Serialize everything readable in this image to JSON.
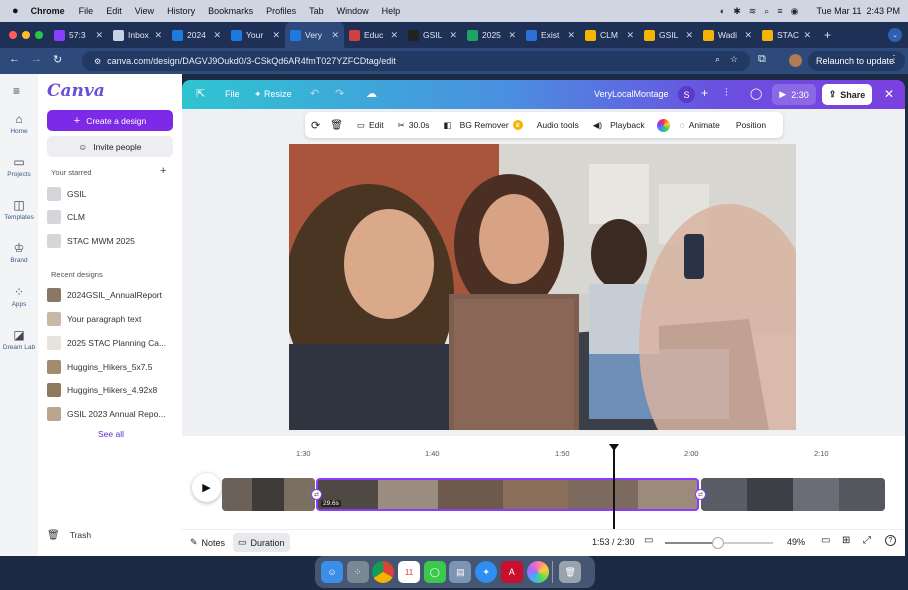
{
  "menubar": {
    "app": "Chrome",
    "items": [
      "File",
      "Edit",
      "View",
      "History",
      "Bookmarks",
      "Profiles",
      "Tab",
      "Window",
      "Help"
    ],
    "datetime": "Tue Mar 11  2:43 PM"
  },
  "tabs": [
    {
      "label": "57:3",
      "favicon_color": "#8a3ffc"
    },
    {
      "label": "Inbox",
      "favicon_color": "#c7d2e6"
    },
    {
      "label": "2024",
      "favicon_color": "#1f7ae0"
    },
    {
      "label": "Your",
      "favicon_color": "#1f7ae0"
    },
    {
      "label": "Very",
      "favicon_color": "#1f7ae0"
    },
    {
      "label": "Educ",
      "favicon_color": "#d04040"
    },
    {
      "label": "GSIL",
      "favicon_color": "#222222"
    },
    {
      "label": "2025",
      "favicon_color": "#1ea362"
    },
    {
      "label": "Exist",
      "favicon_color": "#2a70d9"
    },
    {
      "label": "CLM",
      "favicon_color": "#f4b400"
    },
    {
      "label": "GSIL",
      "favicon_color": "#f4b400"
    },
    {
      "label": "Wadi",
      "favicon_color": "#f4b400"
    },
    {
      "label": "STAC",
      "favicon_color": "#f4b400"
    }
  ],
  "address": {
    "url": "canva.com/design/DAGVJ9Oukd0/3-CSkQd6AR4fmT027YZFCDtag/edit",
    "relaunch": "Relaunch to update"
  },
  "leftnav": [
    {
      "label": "Home",
      "icon": "home-icon"
    },
    {
      "label": "Projects",
      "icon": "folder-icon"
    },
    {
      "label": "Templates",
      "icon": "templates-icon"
    },
    {
      "label": "Brand",
      "icon": "brand-icon"
    },
    {
      "label": "Apps",
      "icon": "apps-icon"
    },
    {
      "label": "Dream Lab",
      "icon": "dreamlab-icon"
    }
  ],
  "panel": {
    "logo": "Canva",
    "create": "Create a design",
    "invite": "Invite people",
    "starred_heading": "Your starred",
    "starred": [
      "GSIL",
      "CLM",
      "STAC MWM 2025"
    ],
    "recent_heading": "Recent designs",
    "recent": [
      "2024GSIL_AnnualReport",
      "Your paragraph text",
      "2025 STAC Planning Ca...",
      "Huggins_Hikers_5x7.5",
      "Huggins_Hikers_4.92x8",
      "GSIL 2023 Annual Repo..."
    ],
    "see_all": "See all",
    "trash": "Trash"
  },
  "topbar": {
    "file": "File",
    "resize": "Resize",
    "title": "VeryLocalMontage",
    "avatar": "S",
    "play_time": "2:30",
    "share": "Share"
  },
  "toolbar": {
    "edit": "Edit",
    "duration": "30.0s",
    "bg_remover": "BG Remover",
    "audio": "Audio tools",
    "playback": "Playback",
    "animate": "Animate",
    "position": "Position"
  },
  "timeline": {
    "ticks": [
      "1:30",
      "1:40",
      "1:50",
      "2:00",
      "2:10"
    ],
    "clip_duration": "29.6s"
  },
  "bottom": {
    "notes": "Notes",
    "duration": "Duration",
    "time": "1:53 / 2:30",
    "zoom": "49%",
    "zoom_fraction": 0.49
  }
}
